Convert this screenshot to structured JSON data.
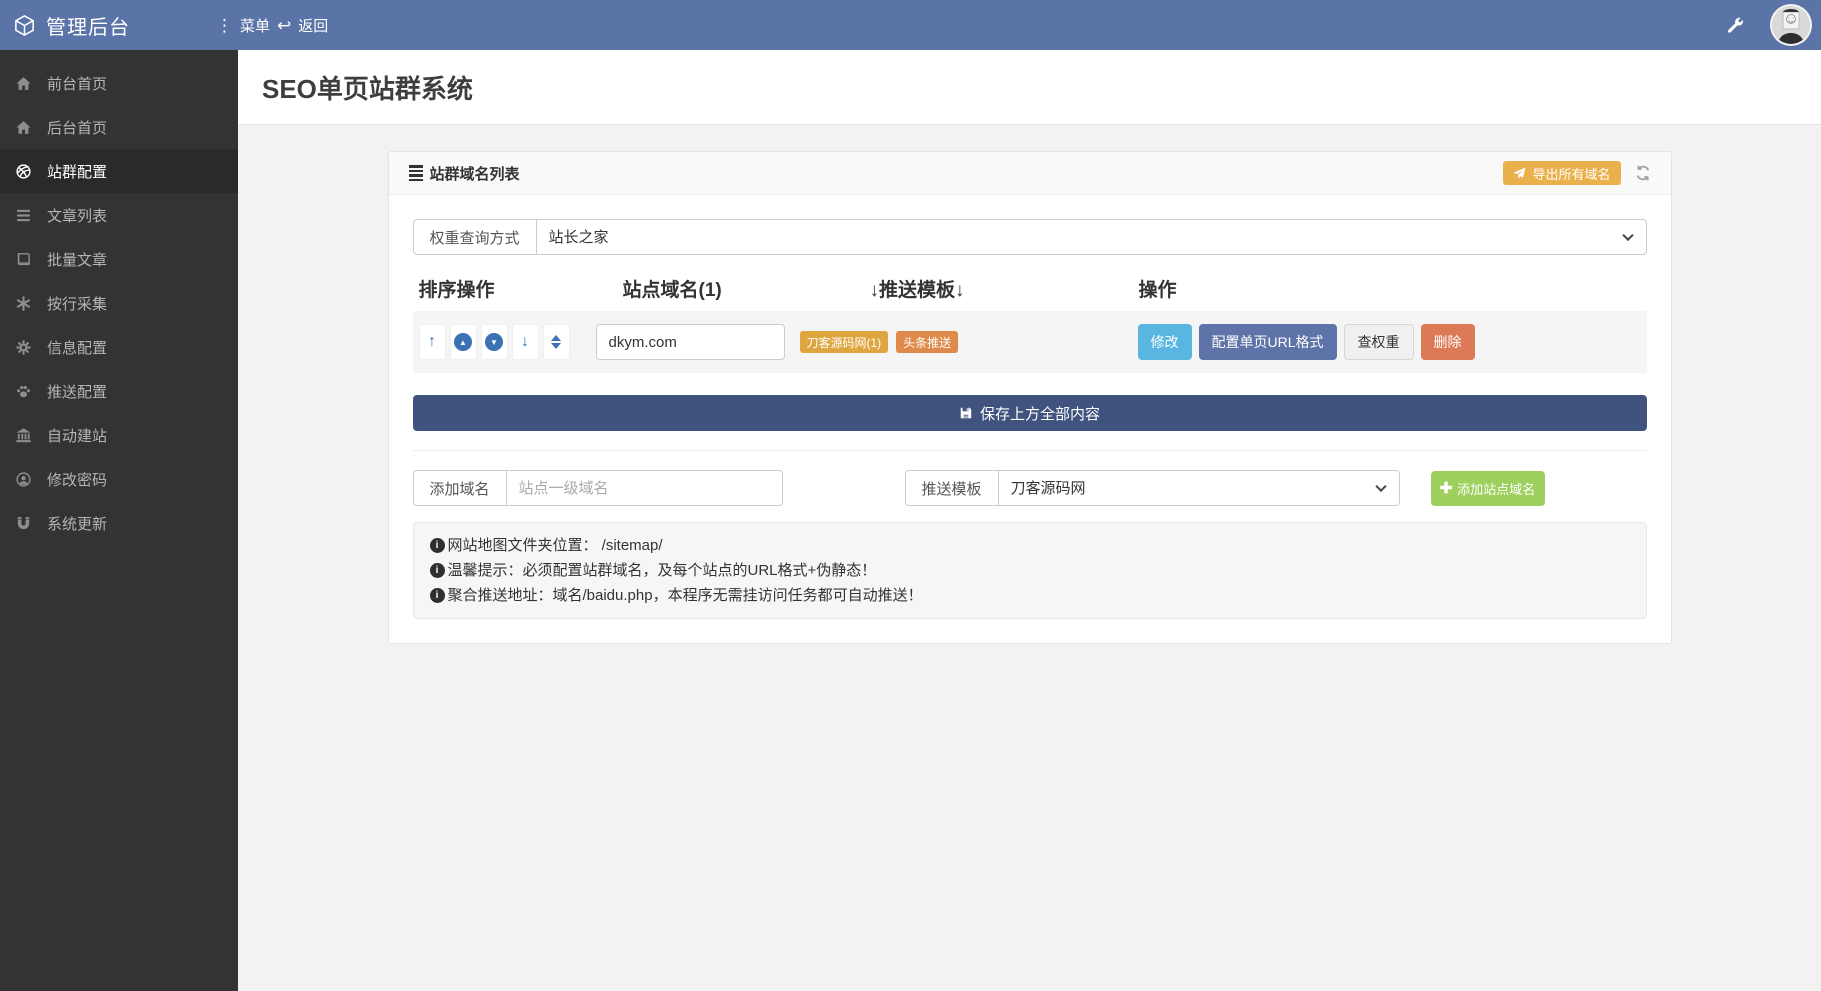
{
  "navbar": {
    "brand": "管理后台",
    "menu": "菜单",
    "back": "返回"
  },
  "page_title": "SEO单页站群系统",
  "sidebar": {
    "items": [
      {
        "label": "前台首页",
        "icon": "home-icon",
        "active": false
      },
      {
        "label": "后台首页",
        "icon": "home-icon",
        "active": false
      },
      {
        "label": "站群配置",
        "icon": "globe-icon",
        "active": true
      },
      {
        "label": "文章列表",
        "icon": "list-icon",
        "active": false
      },
      {
        "label": "批量文章",
        "icon": "book-icon",
        "active": false
      },
      {
        "label": "按行采集",
        "icon": "asterisk-icon",
        "active": false
      },
      {
        "label": "信息配置",
        "icon": "gear-icon",
        "active": false
      },
      {
        "label": "推送配置",
        "icon": "paw-icon",
        "active": false
      },
      {
        "label": "自动建站",
        "icon": "bank-icon",
        "active": false
      },
      {
        "label": "修改密码",
        "icon": "user-icon",
        "active": false
      },
      {
        "label": "系统更新",
        "icon": "magnet-icon",
        "active": false
      }
    ]
  },
  "panel": {
    "title": "站群域名列表",
    "export_button": "导出所有域名",
    "weight_query_label": "权重查询方式",
    "weight_query_value": "站长之家",
    "table_headers": [
      "排序操作",
      "站点域名(1)",
      "↓推送模板↓",
      "操作"
    ],
    "row": {
      "domain": "dkym.com",
      "badge1": "刀客源码网(1)",
      "badge2": "头条推送",
      "btn_edit": "修改",
      "btn_url": "配置单页URL格式",
      "btn_weight": "查权重",
      "btn_delete": "删除"
    },
    "save_button": "保存上方全部内容",
    "add_domain_label": "添加域名",
    "add_domain_placeholder": "站点一级域名",
    "push_template_label": "推送模板",
    "push_template_value": "刀客源码网",
    "add_site_button": "添加站点域名",
    "notes": [
      "网站地图文件夹位置： /sitemap/",
      "温馨提示：必须配置站群域名，及每个站点的URL格式+伪静态！",
      "聚合推送地址：域名/baidu.php，本程序无需挂访问任务都可自动推送！"
    ]
  },
  "colors": {
    "navbar": "#5b74a8",
    "sidebar": "#333333",
    "save_button": "#40537e",
    "primary": "#5e73a8",
    "info": "#58b6e0",
    "danger": "#dc7a57",
    "warning": "#e9b04b",
    "success": "#9ed05e",
    "badge1": "#dfa640",
    "badge2": "#df8a4b",
    "sort_icon": "#3c72b4"
  }
}
